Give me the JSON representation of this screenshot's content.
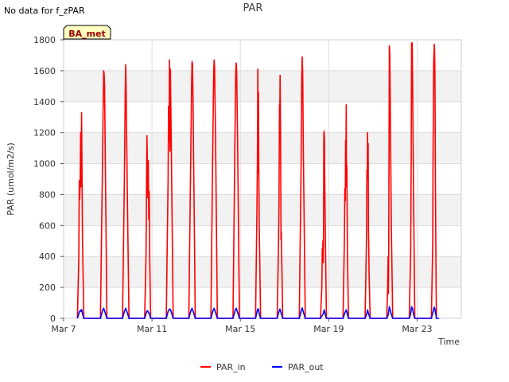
{
  "note": "No data for f_zPAR",
  "badge": "BA_met",
  "chart_data": {
    "type": "line",
    "title": "PAR",
    "xlabel": "Time",
    "ylabel": "PAR (umol/m2/s)",
    "xlim": [
      "2024-03-07T00:00",
      "2024-03-25T00:00"
    ],
    "ylim": [
      0,
      1800
    ],
    "yticks": [
      0,
      200,
      400,
      600,
      800,
      1000,
      1200,
      1400,
      1600,
      1800
    ],
    "xticks": [
      {
        "date": "2024-03-07",
        "label": "Mar 7"
      },
      {
        "date": "2024-03-11",
        "label": "Mar 11"
      },
      {
        "date": "2024-03-15",
        "label": "Mar 15"
      },
      {
        "date": "2024-03-19",
        "label": "Mar 19"
      },
      {
        "date": "2024-03-23",
        "label": "Mar 23"
      }
    ],
    "grid": true,
    "banded_background": true,
    "legend_position": "bottom",
    "series": [
      {
        "name": "PAR_in",
        "color": "#ff0000",
        "points": [
          [
            "2024-03-07T15:00",
            0
          ],
          [
            "2024-03-07T16:30",
            400
          ],
          [
            "2024-03-07T17:00",
            890
          ],
          [
            "2024-03-07T17:30",
            770
          ],
          [
            "2024-03-07T18:00",
            880
          ],
          [
            "2024-03-07T18:30",
            1200
          ],
          [
            "2024-03-07T19:00",
            850
          ],
          [
            "2024-03-07T19:30",
            1330
          ],
          [
            "2024-03-07T20:00",
            900
          ],
          [
            "2024-03-07T20:30",
            500
          ],
          [
            "2024-03-07T22:00",
            0
          ],
          [
            "2024-03-08T16:00",
            0
          ],
          [
            "2024-03-08T18:00",
            900
          ],
          [
            "2024-03-08T19:00",
            1380
          ],
          [
            "2024-03-08T19:30",
            1600
          ],
          [
            "2024-03-08T20:00",
            1580
          ],
          [
            "2024-03-08T20:30",
            1500
          ],
          [
            "2024-03-08T21:00",
            1200
          ],
          [
            "2024-03-08T23:00",
            0
          ],
          [
            "2024-03-09T16:00",
            0
          ],
          [
            "2024-03-09T18:00",
            900
          ],
          [
            "2024-03-09T19:00",
            1500
          ],
          [
            "2024-03-09T19:30",
            1640
          ],
          [
            "2024-03-09T20:00",
            1430
          ],
          [
            "2024-03-09T21:00",
            900
          ],
          [
            "2024-03-09T23:00",
            0
          ],
          [
            "2024-03-10T16:00",
            0
          ],
          [
            "2024-03-10T17:30",
            400
          ],
          [
            "2024-03-10T18:30",
            1180
          ],
          [
            "2024-03-10T19:00",
            1000
          ],
          [
            "2024-03-10T19:30",
            780
          ],
          [
            "2024-03-10T20:00",
            1020
          ],
          [
            "2024-03-10T20:30",
            640
          ],
          [
            "2024-03-10T21:00",
            820
          ],
          [
            "2024-03-10T21:30",
            400
          ],
          [
            "2024-03-10T22:30",
            0
          ],
          [
            "2024-03-11T15:30",
            0
          ],
          [
            "2024-03-11T17:30",
            900
          ],
          [
            "2024-03-11T18:00",
            1370
          ],
          [
            "2024-03-11T18:30",
            1150
          ],
          [
            "2024-03-11T19:00",
            1670
          ],
          [
            "2024-03-11T19:30",
            1080
          ],
          [
            "2024-03-11T20:00",
            1610
          ],
          [
            "2024-03-11T21:00",
            1100
          ],
          [
            "2024-03-11T23:00",
            0
          ],
          [
            "2024-03-12T16:00",
            0
          ],
          [
            "2024-03-12T18:00",
            1000
          ],
          [
            "2024-03-12T19:00",
            1500
          ],
          [
            "2024-03-12T19:30",
            1660
          ],
          [
            "2024-03-12T20:00",
            1640
          ],
          [
            "2024-03-12T20:30",
            1450
          ],
          [
            "2024-03-12T23:00",
            0
          ],
          [
            "2024-03-13T16:00",
            0
          ],
          [
            "2024-03-13T18:00",
            1100
          ],
          [
            "2024-03-13T19:00",
            1580
          ],
          [
            "2024-03-13T19:30",
            1670
          ],
          [
            "2024-03-13T20:00",
            1620
          ],
          [
            "2024-03-13T21:00",
            1200
          ],
          [
            "2024-03-13T23:00",
            0
          ],
          [
            "2024-03-14T16:00",
            0
          ],
          [
            "2024-03-14T18:00",
            1100
          ],
          [
            "2024-03-14T19:00",
            1600
          ],
          [
            "2024-03-14T19:30",
            1650
          ],
          [
            "2024-03-14T20:00",
            1600
          ],
          [
            "2024-03-14T21:00",
            1150
          ],
          [
            "2024-03-14T23:00",
            0
          ],
          [
            "2024-03-15T16:30",
            0
          ],
          [
            "2024-03-15T18:00",
            700
          ],
          [
            "2024-03-15T18:30",
            1000
          ],
          [
            "2024-03-15T19:00",
            1610
          ],
          [
            "2024-03-15T19:20",
            940
          ],
          [
            "2024-03-15T19:40",
            1460
          ],
          [
            "2024-03-15T20:00",
            1000
          ],
          [
            "2024-03-15T20:30",
            600
          ],
          [
            "2024-03-15T22:00",
            0
          ],
          [
            "2024-03-16T16:00",
            0
          ],
          [
            "2024-03-16T17:30",
            500
          ],
          [
            "2024-03-16T18:00",
            770
          ],
          [
            "2024-03-16T18:30",
            1380
          ],
          [
            "2024-03-16T18:50",
            1310
          ],
          [
            "2024-03-16T19:10",
            1570
          ],
          [
            "2024-03-16T19:40",
            1200
          ],
          [
            "2024-03-16T20:10",
            510
          ],
          [
            "2024-03-16T20:30",
            560
          ],
          [
            "2024-03-16T22:00",
            0
          ],
          [
            "2024-03-17T16:00",
            0
          ],
          [
            "2024-03-17T18:00",
            1000
          ],
          [
            "2024-03-17T18:40",
            1550
          ],
          [
            "2024-03-17T19:10",
            1690
          ],
          [
            "2024-03-17T19:40",
            1600
          ],
          [
            "2024-03-17T20:30",
            1050
          ],
          [
            "2024-03-17T22:30",
            0
          ],
          [
            "2024-03-18T15:00",
            0
          ],
          [
            "2024-03-18T16:30",
            200
          ],
          [
            "2024-03-18T17:00",
            450
          ],
          [
            "2024-03-18T17:20",
            380
          ],
          [
            "2024-03-18T17:40",
            500
          ],
          [
            "2024-03-18T18:00",
            360
          ],
          [
            "2024-03-18T18:20",
            520
          ],
          [
            "2024-03-18T18:40",
            1180
          ],
          [
            "2024-03-18T19:00",
            1210
          ],
          [
            "2024-03-18T19:20",
            1150
          ],
          [
            "2024-03-18T20:00",
            700
          ],
          [
            "2024-03-18T21:30",
            0
          ],
          [
            "2024-03-19T15:30",
            0
          ],
          [
            "2024-03-19T17:00",
            500
          ],
          [
            "2024-03-19T17:30",
            840
          ],
          [
            "2024-03-19T18:00",
            760
          ],
          [
            "2024-03-19T18:20",
            1150
          ],
          [
            "2024-03-19T18:40",
            1000
          ],
          [
            "2024-03-19T19:00",
            1380
          ],
          [
            "2024-03-19T19:20",
            850
          ],
          [
            "2024-03-19T19:40",
            990
          ],
          [
            "2024-03-19T20:20",
            400
          ],
          [
            "2024-03-19T21:30",
            0
          ],
          [
            "2024-03-20T15:30",
            0
          ],
          [
            "2024-03-20T17:00",
            500
          ],
          [
            "2024-03-20T17:30",
            960
          ],
          [
            "2024-03-20T17:50",
            900
          ],
          [
            "2024-03-20T18:10",
            1200
          ],
          [
            "2024-03-20T18:30",
            900
          ],
          [
            "2024-03-20T18:50",
            1130
          ],
          [
            "2024-03-20T19:10",
            570
          ],
          [
            "2024-03-20T19:30",
            470
          ],
          [
            "2024-03-20T19:50",
            290
          ],
          [
            "2024-03-20T20:10",
            210
          ],
          [
            "2024-03-20T21:00",
            0
          ],
          [
            "2024-03-21T15:00",
            0
          ],
          [
            "2024-03-21T16:00",
            200
          ],
          [
            "2024-03-21T16:30",
            400
          ],
          [
            "2024-03-21T16:50",
            160
          ],
          [
            "2024-03-21T17:10",
            450
          ],
          [
            "2024-03-21T17:30",
            1050
          ],
          [
            "2024-03-21T17:50",
            1760
          ],
          [
            "2024-03-21T18:20",
            1720
          ],
          [
            "2024-03-21T19:00",
            1300
          ],
          [
            "2024-03-21T20:00",
            600
          ],
          [
            "2024-03-21T21:30",
            0
          ],
          [
            "2024-03-22T15:30",
            0
          ],
          [
            "2024-03-22T17:00",
            420
          ],
          [
            "2024-03-22T17:40",
            1100
          ],
          [
            "2024-03-22T18:00",
            1780
          ],
          [
            "2024-03-22T18:20",
            1720
          ],
          [
            "2024-03-22T18:40",
            1780
          ],
          [
            "2024-03-22T19:10",
            1500
          ],
          [
            "2024-03-22T20:00",
            900
          ],
          [
            "2024-03-22T21:30",
            0
          ],
          [
            "2024-03-23T15:30",
            0
          ],
          [
            "2024-03-23T17:00",
            480
          ],
          [
            "2024-03-23T17:20",
            1080
          ],
          [
            "2024-03-23T17:40",
            1290
          ],
          [
            "2024-03-23T18:00",
            1650
          ],
          [
            "2024-03-23T18:20",
            1710
          ],
          [
            "2024-03-23T18:40",
            1770
          ],
          [
            "2024-03-23T19:00",
            1730
          ],
          [
            "2024-03-23T19:20",
            1600
          ],
          [
            "2024-03-23T20:00",
            800
          ],
          [
            "2024-03-23T20:40",
            200
          ],
          [
            "2024-03-23T21:00",
            0
          ]
        ]
      },
      {
        "name": "PAR_out",
        "color": "#0000ff",
        "points": [
          [
            "2024-03-07T15:00",
            0
          ],
          [
            "2024-03-07T17:00",
            40
          ],
          [
            "2024-03-07T18:00",
            50
          ],
          [
            "2024-03-07T19:00",
            45
          ],
          [
            "2024-03-07T19:30",
            58
          ],
          [
            "2024-03-07T20:30",
            30
          ],
          [
            "2024-03-07T22:00",
            0
          ],
          [
            "2024-03-08T16:00",
            0
          ],
          [
            "2024-03-08T18:00",
            45
          ],
          [
            "2024-03-08T19:30",
            65
          ],
          [
            "2024-03-08T21:00",
            40
          ],
          [
            "2024-03-08T23:00",
            0
          ],
          [
            "2024-03-09T16:00",
            0
          ],
          [
            "2024-03-09T18:00",
            45
          ],
          [
            "2024-03-09T19:30",
            65
          ],
          [
            "2024-03-09T21:00",
            40
          ],
          [
            "2024-03-09T23:00",
            0
          ],
          [
            "2024-03-10T16:00",
            0
          ],
          [
            "2024-03-10T18:00",
            40
          ],
          [
            "2024-03-10T19:00",
            50
          ],
          [
            "2024-03-10T20:00",
            40
          ],
          [
            "2024-03-10T21:30",
            25
          ],
          [
            "2024-03-10T22:30",
            0
          ],
          [
            "2024-03-11T15:30",
            0
          ],
          [
            "2024-03-11T17:30",
            45
          ],
          [
            "2024-03-11T19:00",
            60
          ],
          [
            "2024-03-11T20:00",
            58
          ],
          [
            "2024-03-11T21:00",
            40
          ],
          [
            "2024-03-11T23:00",
            0
          ],
          [
            "2024-03-12T16:00",
            0
          ],
          [
            "2024-03-12T18:00",
            45
          ],
          [
            "2024-03-12T19:30",
            65
          ],
          [
            "2024-03-12T21:00",
            40
          ],
          [
            "2024-03-12T23:00",
            0
          ],
          [
            "2024-03-13T16:00",
            0
          ],
          [
            "2024-03-13T18:00",
            45
          ],
          [
            "2024-03-13T19:30",
            65
          ],
          [
            "2024-03-13T21:00",
            40
          ],
          [
            "2024-03-13T23:00",
            0
          ],
          [
            "2024-03-14T16:00",
            0
          ],
          [
            "2024-03-14T18:00",
            45
          ],
          [
            "2024-03-14T19:30",
            65
          ],
          [
            "2024-03-14T21:00",
            40
          ],
          [
            "2024-03-14T23:00",
            0
          ],
          [
            "2024-03-15T16:30",
            0
          ],
          [
            "2024-03-15T18:00",
            40
          ],
          [
            "2024-03-15T19:00",
            62
          ],
          [
            "2024-03-15T19:40",
            58
          ],
          [
            "2024-03-15T20:30",
            30
          ],
          [
            "2024-03-15T22:00",
            0
          ],
          [
            "2024-03-16T16:00",
            0
          ],
          [
            "2024-03-16T17:30",
            35
          ],
          [
            "2024-03-16T19:00",
            60
          ],
          [
            "2024-03-16T20:30",
            30
          ],
          [
            "2024-03-16T22:00",
            0
          ],
          [
            "2024-03-17T16:00",
            0
          ],
          [
            "2024-03-17T18:00",
            45
          ],
          [
            "2024-03-17T19:10",
            68
          ],
          [
            "2024-03-17T20:30",
            40
          ],
          [
            "2024-03-17T22:30",
            0
          ],
          [
            "2024-03-18T15:00",
            0
          ],
          [
            "2024-03-18T17:00",
            20
          ],
          [
            "2024-03-18T18:00",
            30
          ],
          [
            "2024-03-18T19:00",
            55
          ],
          [
            "2024-03-18T20:00",
            30
          ],
          [
            "2024-03-18T21:30",
            0
          ],
          [
            "2024-03-19T15:30",
            0
          ],
          [
            "2024-03-19T17:30",
            35
          ],
          [
            "2024-03-19T19:00",
            55
          ],
          [
            "2024-03-19T20:20",
            25
          ],
          [
            "2024-03-19T21:30",
            0
          ],
          [
            "2024-03-20T15:30",
            0
          ],
          [
            "2024-03-20T17:30",
            35
          ],
          [
            "2024-03-20T18:10",
            55
          ],
          [
            "2024-03-20T19:30",
            25
          ],
          [
            "2024-03-20T21:00",
            0
          ],
          [
            "2024-03-21T15:00",
            0
          ],
          [
            "2024-03-21T16:30",
            20
          ],
          [
            "2024-03-21T17:50",
            75
          ],
          [
            "2024-03-21T19:00",
            50
          ],
          [
            "2024-03-21T20:00",
            25
          ],
          [
            "2024-03-21T21:30",
            0
          ],
          [
            "2024-03-22T15:30",
            0
          ],
          [
            "2024-03-22T17:00",
            30
          ],
          [
            "2024-03-22T18:00",
            75
          ],
          [
            "2024-03-22T19:10",
            60
          ],
          [
            "2024-03-22T20:00",
            30
          ],
          [
            "2024-03-22T21:30",
            0
          ],
          [
            "2024-03-23T15:30",
            0
          ],
          [
            "2024-03-23T17:00",
            35
          ],
          [
            "2024-03-23T18:40",
            72
          ],
          [
            "2024-03-23T19:20",
            60
          ],
          [
            "2024-03-23T20:40",
            15
          ],
          [
            "2024-03-23T21:00",
            0
          ],
          [
            "2024-03-24T00:00",
            0
          ]
        ]
      }
    ]
  }
}
